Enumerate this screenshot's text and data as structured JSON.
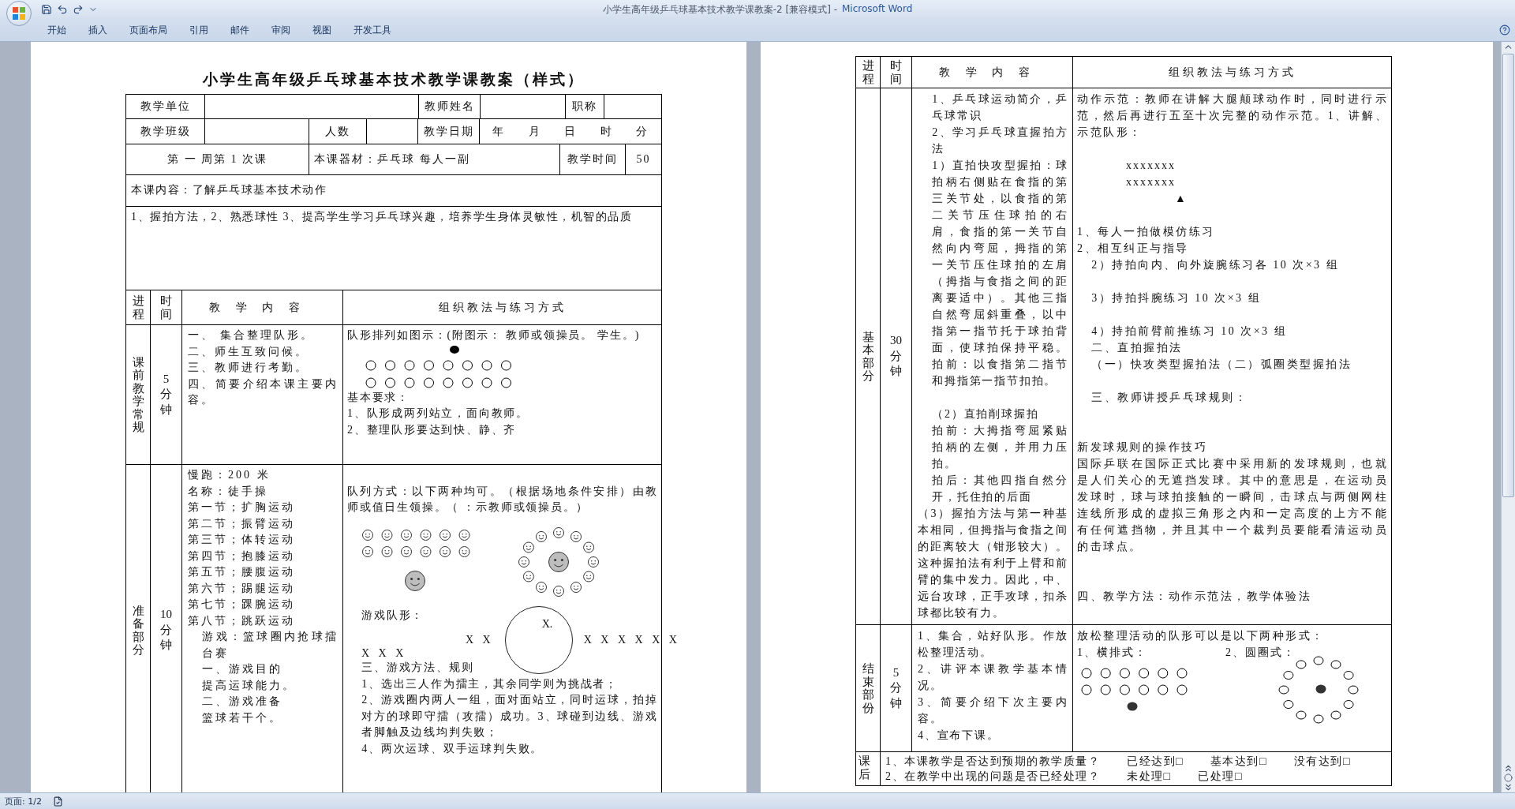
{
  "window": {
    "title": "小学生高年级乒乓球基本技术教学课教案-2 [兼容模式] -",
    "app": "Microsoft Word"
  },
  "ribbon_tabs": [
    {
      "label": "开始"
    },
    {
      "label": "插入"
    },
    {
      "label": "页面布局"
    },
    {
      "label": "引用"
    },
    {
      "label": "邮件"
    },
    {
      "label": "审阅"
    },
    {
      "label": "视图"
    },
    {
      "label": "开发工具"
    }
  ],
  "page_1": {
    "title": "小学生高年级乒乓球基本技术教学课教案（样式）",
    "info_rows": [
      [
        {
          "kind": "label",
          "text": "教学单位"
        },
        {
          "kind": "blank"
        },
        {
          "kind": "label",
          "text": "教师姓名"
        },
        {
          "kind": "blank"
        },
        {
          "kind": "label",
          "text": "职称"
        },
        {
          "kind": "blank"
        }
      ],
      [
        {
          "kind": "label",
          "text": "教学班级"
        },
        {
          "kind": "blank"
        },
        {
          "kind": "label",
          "text": "人数"
        },
        {
          "kind": "blank"
        },
        {
          "kind": "label",
          "text": "教学日期"
        },
        {
          "kind": "date",
          "text": "年 月 日 时 分"
        }
      ],
      [
        {
          "kind": "label",
          "text": "第 一 周第 1 次课"
        },
        {
          "kind": "value",
          "text": "本课器材：乒乓球 每人一副"
        },
        {
          "kind": "label",
          "text": "教学时间"
        },
        {
          "kind": "label",
          "text": "50"
        }
      ]
    ],
    "lesson_content": "本课内容：了解乒乓球基本技术动作",
    "objectives": "1、握拍方法，2、熟悉球性 3、提高学生学习乒乓球兴趣，培养学生身体灵敏性，机智的品质",
    "lesson_table": {
      "columns": [
        "进程",
        "时间",
        "教学内容",
        "组织教法与练习方式"
      ],
      "rows": [
        {
          "phase": "课前教学常规",
          "time": "5分钟",
          "content": [
            {
              "kind": "text",
              "indent": false,
              "text": "一、 集合整理队形。"
            },
            {
              "kind": "text",
              "indent": false,
              "text": "二、师生互致问候。"
            },
            {
              "kind": "text",
              "indent": false,
              "text": "三、教师进行考勤。"
            },
            {
              "kind": "text",
              "indent": false,
              "text": "四、简要介绍本课主要内容。"
            }
          ],
          "methods": [
            {
              "kind": "text",
              "indent": false,
              "text": "队形排列如图示：(附图示：    教师或领操员。    学生。)"
            },
            {
              "kind": "dot_formation"
            },
            {
              "kind": "text",
              "indent": false,
              "text": "基本要求："
            },
            {
              "kind": "text",
              "indent": false,
              "text": "1、队形成两列站立，面向教师。"
            },
            {
              "kind": "text",
              "indent": false,
              "text": "2、整理队形要达到快、静、齐"
            }
          ]
        },
        {
          "phase": "准备部分",
          "time": "10分钟",
          "content": [
            {
              "kind": "text",
              "indent": false,
              "text": "慢跑：200 米"
            },
            {
              "kind": "text",
              "indent": false,
              "text": "名称：徒手操"
            },
            {
              "kind": "text",
              "indent": false,
              "text": "第一节；扩胸运动"
            },
            {
              "kind": "text",
              "indent": false,
              "text": "第二节；振臂运动"
            },
            {
              "kind": "text",
              "indent": false,
              "text": "第三节；体转运动"
            },
            {
              "kind": "text",
              "indent": false,
              "text": "第四节；抱膝运动"
            },
            {
              "kind": "text",
              "indent": false,
              "text": "第五节；腰腹运动"
            },
            {
              "kind": "text",
              "indent": false,
              "text": "第六节；踢腿运动"
            },
            {
              "kind": "text",
              "indent": false,
              "text": "第七节；踝腕运动"
            },
            {
              "kind": "text",
              "indent": false,
              "text": "第八节；跳跃运动"
            },
            {
              "kind": "text",
              "indent": true,
              "text": "游戏：篮球圈内抢球擂台赛"
            },
            {
              "kind": "text",
              "indent": true,
              "text": "一、游戏目的"
            },
            {
              "kind": "text",
              "indent": true,
              "text": "提高运球能力。"
            },
            {
              "kind": "text",
              "indent": true,
              "text": "二、游戏准备"
            },
            {
              "kind": "text",
              "indent": true,
              "text": "篮球若干个。"
            }
          ],
          "methods": [
            {
              "kind": "gap"
            },
            {
              "kind": "text",
              "indent": false,
              "text": "队列方式：以下两种均可。（根据场地条件安排）由教师或值日生领操。（      ：示教师或领操员。）"
            },
            {
              "kind": "smiley_formations"
            },
            {
              "kind": "text",
              "indent": true,
              "text": "游戏队形："
            },
            {
              "kind": "game_formation",
              "left": "X X",
              "inner": "X.",
              "right": "X X X X X X",
              "below": "X X X"
            },
            {
              "kind": "text",
              "indent": true,
              "text": "三、游戏方法、规则"
            },
            {
              "kind": "text",
              "indent": true,
              "text": "1、选出三人作为擂主，其余同学则为挑战者；"
            },
            {
              "kind": "text",
              "indent": true,
              "text": "2、游戏圈内两人一组，面对面站立，同时运球，拍掉对方的球即守擂（攻擂）成功。3、球碰到边线、游戏者脚触及边线均判失败；"
            },
            {
              "kind": "text",
              "indent": true,
              "text": "4、两次运球、双手运球判失败。"
            }
          ]
        }
      ]
    }
  },
  "page_2": {
    "lesson_table": {
      "columns": [
        "进程",
        "时间",
        "教学内容",
        "组织教法与练习方式"
      ],
      "rows": [
        {
          "phase": "基本部分",
          "time": "30分钟",
          "content": [
            {
              "kind": "text",
              "indent": true,
              "text": "1、乒乓球运动简介，乒乓球常识"
            },
            {
              "kind": "text",
              "indent": true,
              "text": "2、学习乒乓球直握拍方法"
            },
            {
              "kind": "text",
              "indent": true,
              "text": "1）直拍快攻型握拍：球拍柄右侧贴在食指的第三关节处，以食指的第二关节压住球拍的右肩，食指的第一关节自然向内弯屈，拇指的第一关节压住球拍的左肩（拇指与食指之间的距离要适中）。其他三指自然弯屈斜重叠，以中指第一指节托于球拍背面，使球拍保持平稳。拍前：以食指第二指节和拇指第一指节扣拍。"
            },
            {
              "kind": "gap"
            },
            {
              "kind": "text",
              "indent": true,
              "text": "（2）直拍削球握拍"
            },
            {
              "kind": "text",
              "indent": true,
              "text": "拍前：大拇指弯屈紧贴拍柄的左侧，并用力压拍。"
            },
            {
              "kind": "text",
              "indent": true,
              "text": "拍后：其他四指自然分开，托住拍的后面"
            },
            {
              "kind": "text",
              "indent": false,
              "text": "（3）握拍方法与第一种基本相同，但拇指与食指之间的距离较大（钳形较大）。这种握拍法有利于上臂和前臂的集中发力。因此，中、远台攻球，正手攻球，扣杀球都比较有力。"
            }
          ],
          "methods": [
            {
              "kind": "text",
              "indent": false,
              "text": "动作示范：教师在讲解大腿颠球动作时，同时进行示范，然后再进行五至十次完整的动作示范。1、讲解、示范队形："
            },
            {
              "kind": "gap"
            },
            {
              "kind": "x_formation",
              "lines": [
                "xxxxxxx",
                "xxxxxxx"
              ],
              "marker": "▲"
            },
            {
              "kind": "gap"
            },
            {
              "kind": "text",
              "indent": false,
              "text": "1、每人一拍做模仿练习"
            },
            {
              "kind": "text",
              "indent": false,
              "text": "2、相互纠正与指导"
            },
            {
              "kind": "text",
              "indent": true,
              "text": "2）持拍向内、向外旋腕练习各 10 次×3 组"
            },
            {
              "kind": "gap"
            },
            {
              "kind": "text",
              "indent": true,
              "text": "3）持拍抖腕练习 10 次×3 组"
            },
            {
              "kind": "gap"
            },
            {
              "kind": "text",
              "indent": true,
              "text": "4）持拍前臂前推练习 10 次×3 组"
            },
            {
              "kind": "text",
              "indent": true,
              "text": "二、直拍握拍法"
            },
            {
              "kind": "text",
              "indent": true,
              "text": "（一）快攻类型握拍法（二）弧圈类型握拍法"
            },
            {
              "kind": "gap"
            },
            {
              "kind": "text",
              "indent": true,
              "text": "三、教师讲授乒乓球规则："
            },
            {
              "kind": "gap"
            },
            {
              "kind": "gap"
            },
            {
              "kind": "text",
              "indent": false,
              "text": "新发球规则的操作技巧"
            },
            {
              "kind": "text",
              "indent": false,
              "text": "国际乒联在国际正式比赛中采用新的发球规则，也就是人们关心的无遮挡发球。其中的意思是，在运动员发球时，球与球拍接触的一瞬间，击球点与两侧网柱连线所形成的虚拟三角形之内和一定高度的上方不能有任何遮挡物，并且其中一个裁判员要能看清运动员的击球点。"
            },
            {
              "kind": "gap"
            },
            {
              "kind": "gap"
            },
            {
              "kind": "text",
              "indent": false,
              "text": "四、教学方法：动作示范法，教学体验法"
            }
          ]
        },
        {
          "phase": "结束部份",
          "time": "5分钟",
          "content": [
            {
              "kind": "text",
              "indent": false,
              "text": "1、集合，站好队形。作放松整理活动。"
            },
            {
              "kind": "text",
              "indent": false,
              "text": "2、讲评本课教学基本情况。"
            },
            {
              "kind": "text",
              "indent": false,
              "text": "3、简要介绍下次主要内容。"
            },
            {
              "kind": "text",
              "indent": false,
              "text": "4、宣布下课。"
            }
          ],
          "methods": [
            {
              "kind": "text",
              "indent": false,
              "text": "放松整理活动的队形可以是以下两种形式："
            },
            {
              "kind": "closing_formations",
              "labels": [
                "1、横排式：",
                "2、圆圈式："
              ]
            }
          ]
        }
      ],
      "review": {
        "phase": "课后",
        "lines": [
          {
            "question": "1、本课教学是否达到预期的教学质量？",
            "options": [
              "已经达到□",
              "基本达到□",
              "没有达到□"
            ]
          },
          {
            "question": "2、在教学中出现的问题是否已经处理？",
            "options": [
              "未处理□",
              "已处理□"
            ]
          }
        ]
      }
    }
  },
  "status_bar": {
    "page": "页面: 1/2"
  }
}
